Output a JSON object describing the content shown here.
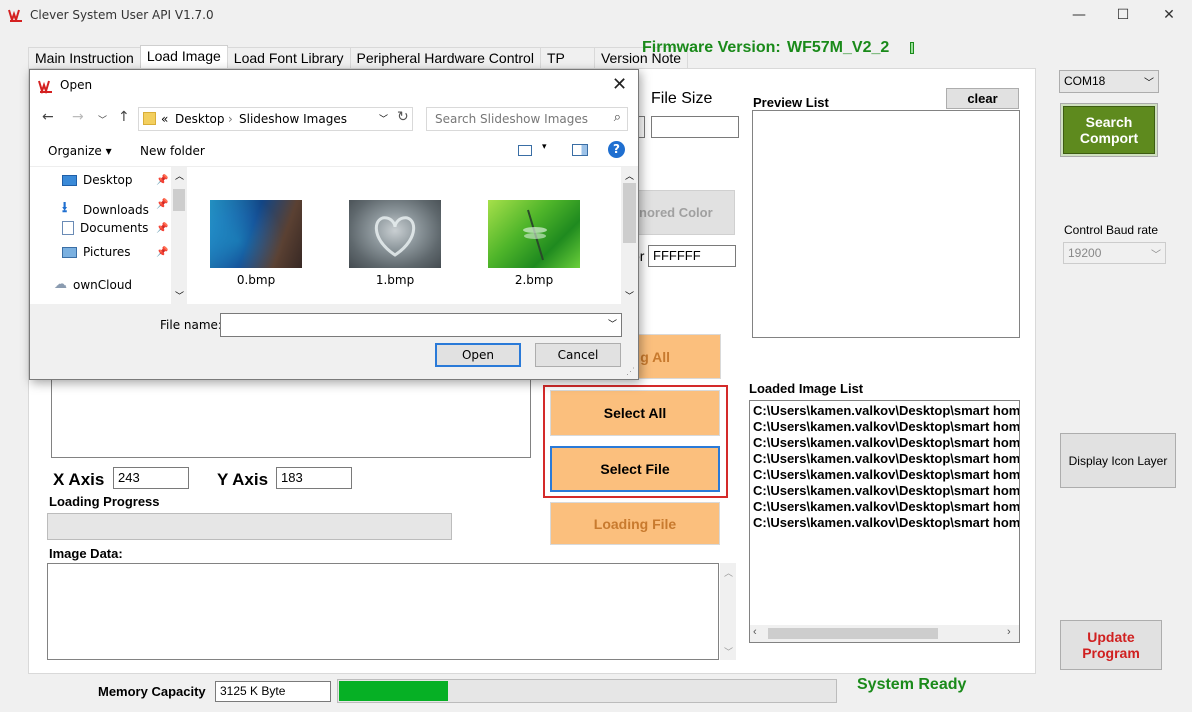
{
  "window": {
    "title": "Clever System User API V1.7.0",
    "minimize": "—",
    "maximize": "☐",
    "close": "✕"
  },
  "tabs": [
    "Main Instruction",
    "Load Image",
    "Load Font Library",
    "Peripheral Hardware Control",
    "TP",
    "Version Note"
  ],
  "firmware": {
    "label": "Firmware Version:",
    "value": "WF57M_V2_2"
  },
  "file_size": {
    "label": "File Size",
    "value": ""
  },
  "ignored_color": {
    "label": "nored Color",
    "prefix": "or",
    "value": "FFFFFF"
  },
  "preview": {
    "label": "Preview List",
    "clear": "clear"
  },
  "buttons": {
    "loading_all": "g All",
    "select_all": "Select All",
    "select_file": "Select File",
    "loading_file": "Loading File"
  },
  "axis": {
    "x_label": "X Axis",
    "x_value": "243",
    "y_label": "Y Axis",
    "y_value": "183"
  },
  "loading_progress": {
    "label": "Loading Progress"
  },
  "image_data": {
    "label": "Image Data:"
  },
  "loaded_list": {
    "label": "Loaded Image List",
    "items": [
      "C:\\Users\\kamen.valkov\\Desktop\\smart home",
      "C:\\Users\\kamen.valkov\\Desktop\\smart home",
      "C:\\Users\\kamen.valkov\\Desktop\\smart home",
      "C:\\Users\\kamen.valkov\\Desktop\\smart home",
      "C:\\Users\\kamen.valkov\\Desktop\\smart home",
      "C:\\Users\\kamen.valkov\\Desktop\\smart home",
      "C:\\Users\\kamen.valkov\\Desktop\\smart home",
      "C:\\Users\\kamen.valkov\\Desktop\\smart home"
    ]
  },
  "right_panel": {
    "com_port": "COM18",
    "search_comport": "Search Comport",
    "baud_label": "Control Baud rate",
    "baud_value": "19200",
    "display_icon_layer": "Display Icon Layer",
    "update_program": "Update Program"
  },
  "memory": {
    "label": "Memory Capacity",
    "value": "3125 K Byte",
    "usage_fraction": 0.22
  },
  "status": "System Ready",
  "colors": {
    "green_text": "#1a8a1a",
    "orange": "#fbbf7d",
    "olive_button": "#5e8a1e",
    "update_red": "#d02020",
    "progress_green": "#06b025"
  },
  "open_dialog": {
    "title": "Open",
    "breadcrumb": [
      "«",
      "Desktop",
      "›",
      "Slideshow Images"
    ],
    "search_placeholder": "Search Slideshow Images",
    "organize": "Organize ▾",
    "new_folder": "New folder",
    "nav_items": [
      "Desktop",
      "Downloads",
      "Documents",
      "Pictures",
      "ownCloud"
    ],
    "files": [
      "0.bmp",
      "1.bmp",
      "2.bmp"
    ],
    "filename_label": "File name:",
    "filename_value": "",
    "open": "Open",
    "cancel": "Cancel"
  }
}
